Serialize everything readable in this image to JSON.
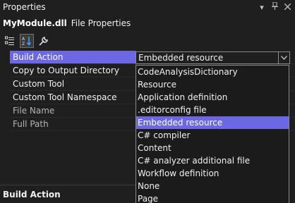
{
  "window": {
    "title": "Properties",
    "menu_glyph": "▾",
    "pin_glyph": "ꟷ",
    "close_glyph": "✕"
  },
  "object": {
    "name": "MyModule.dll",
    "type": "File Properties"
  },
  "toolbar": {
    "categorized_icon": "categorized-icon",
    "alphabetical_icon": "sort-alphabetical-icon",
    "property_pages_icon": "wrench-icon"
  },
  "properties": [
    {
      "name": "Build Action",
      "value": "Embedded resource"
    },
    {
      "name": "Copy to Output Directory",
      "value": ""
    },
    {
      "name": "Custom Tool",
      "value": ""
    },
    {
      "name": "Custom Tool Namespace",
      "value": ""
    },
    {
      "name": "File Name",
      "value": ""
    },
    {
      "name": "Full Path",
      "value": ""
    }
  ],
  "dropdown": {
    "selected": "Embedded resource",
    "options": [
      "CodeAnalysisDictionary",
      "Resource",
      "Application definition",
      ".editorconfig file",
      "Embedded resource",
      "C# compiler",
      "Content",
      "C# analyzer additional file",
      "Workflow definition",
      "None",
      "Page"
    ]
  },
  "description": {
    "title": "Build Action"
  },
  "colors": {
    "background": "#1f1f1f",
    "accent": "#6c67e3",
    "border": "#8a8a8a"
  }
}
